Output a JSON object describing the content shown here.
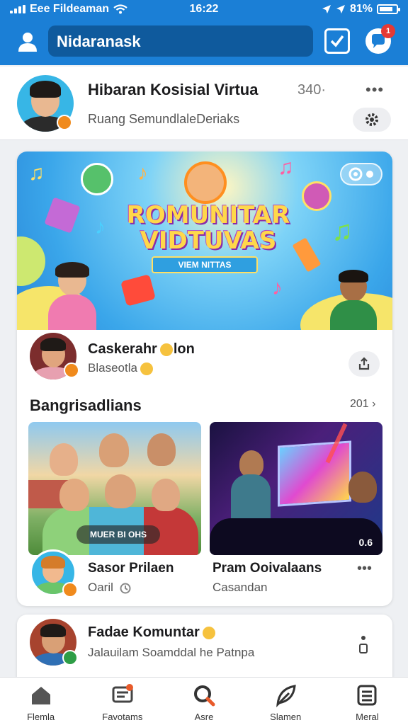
{
  "status_bar": {
    "carrier": "Eee Fildeaman",
    "time": "16:22",
    "battery": "81%"
  },
  "header": {
    "search_text": "Nidaranask",
    "notification_count": "1"
  },
  "profile": {
    "title": "Hibaran Kosisial Virtua",
    "count": "340·",
    "subtitle": "Ruang SemundlaleDeriaks"
  },
  "banner": {
    "title_line1": "ROMUNITAR",
    "title_line2": "VIDTUVAS",
    "ribbon": "VIEM NITTAS"
  },
  "post": {
    "author": "Caskerahr",
    "author_suffix": "lon",
    "sub": "Blaseotla"
  },
  "section": {
    "title": "Bangrisadlians",
    "count": "201"
  },
  "items": [
    {
      "thumb_label": "MUER BI OHS",
      "name": "Sasor Prilaen",
      "sub": "Oaril"
    },
    {
      "thumb_info": "0.6",
      "name": "Pram Ooivalaans",
      "sub": "Casandan"
    }
  ],
  "post2": {
    "title": "Fadae Komuntar",
    "sub": "Jalauilam Soamddal he Patnpa"
  },
  "nav": [
    {
      "label": "Flemla",
      "icon": "home-icon"
    },
    {
      "label": "Favotams",
      "icon": "chat-icon"
    },
    {
      "label": "Asre",
      "icon": "search-icon"
    },
    {
      "label": "Slamen",
      "icon": "leaf-icon"
    },
    {
      "label": "Meral",
      "icon": "menu-icon"
    }
  ],
  "colors": {
    "brand": "#1b7fd6",
    "search_bg": "#0f5a9d",
    "badge": "#e53935",
    "accent_orange": "#f08a1c",
    "accent_green": "#2e9d46"
  }
}
